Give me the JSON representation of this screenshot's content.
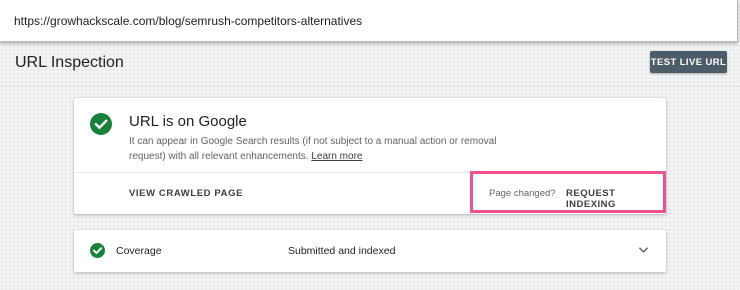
{
  "browser": {
    "url": "https://growhackscale.com/blog/semrush-competitors-alternatives"
  },
  "header": {
    "title": "URL Inspection",
    "test_live_label": "TEST LIVE URL"
  },
  "status_card": {
    "icon": "check-circle-icon",
    "title": "URL is on Google",
    "description": "It can appear in Google Search results (if not subject to a manual action or removal request) with all relevant enhancements.",
    "learn_more": "Learn more",
    "view_crawled_label": "VIEW CRAWLED PAGE",
    "page_changed_label": "Page changed?",
    "request_indexing_label": "REQUEST INDEXING"
  },
  "coverage": {
    "icon": "check-circle-icon",
    "label": "Coverage",
    "value": "Submitted and indexed",
    "expand_icon": "chevron-down-icon"
  },
  "colors": {
    "success_green": "#188038",
    "highlight_pink": "#f0508e",
    "button_bg": "#4d5c66"
  }
}
